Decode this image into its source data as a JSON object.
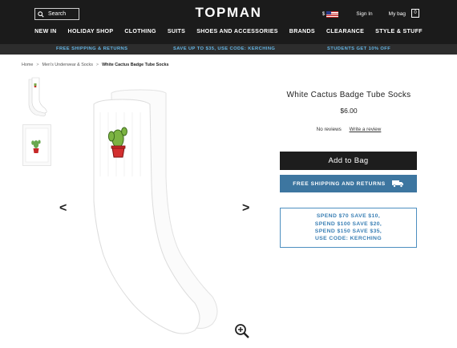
{
  "header": {
    "search_label": "Search",
    "logo": "TOPMAN",
    "currency": "$",
    "sign_in": "Sign In",
    "my_bag": "My bag",
    "bag_count": "0"
  },
  "nav": {
    "items": [
      {
        "label": "NEW IN"
      },
      {
        "label": "HOLIDAY SHOP"
      },
      {
        "label": "CLOTHING"
      },
      {
        "label": "SUITS"
      },
      {
        "label": "SHOES AND ACCESSORIES"
      },
      {
        "label": "BRANDS"
      },
      {
        "label": "CLEARANCE"
      },
      {
        "label": "STYLE & STUFF"
      }
    ]
  },
  "promo": {
    "left": "FREE SHIPPING & RETURNS",
    "center": "SAVE UP TO $35, USE CODE: KERCHING",
    "right": "STUDENTS GET 10% OFF"
  },
  "breadcrumb": {
    "items": [
      {
        "label": "Home"
      },
      {
        "label": "Men's Underwear & Socks"
      },
      {
        "label": "White Cactus Badge Tube Socks"
      }
    ]
  },
  "product": {
    "title": "White Cactus Badge Tube Socks",
    "price": "$6.00",
    "reviews": "No reviews",
    "write_review": "Write a review",
    "add_to_bag": "Add to Bag",
    "shipping_button": "FREE SHIPPING AND RETURNS",
    "offers": [
      "SPEND $70 SAVE $10,",
      "SPEND $100 SAVE $20,",
      "SPEND $150 SAVE $35,",
      "USE CODE: KERCHING"
    ]
  },
  "gallery": {
    "prev": "<",
    "next": ">"
  },
  "colors": {
    "header_bg": "#1b1b1b",
    "promo_text": "#64b5e4",
    "shipping_button": "#3d76a0",
    "offer_border": "#4d8fc0"
  },
  "icons": [
    "search-icon",
    "flag-icon",
    "bag-icon",
    "truck-icon",
    "zoom-icon",
    "chevron-left-icon",
    "chevron-right-icon"
  ]
}
